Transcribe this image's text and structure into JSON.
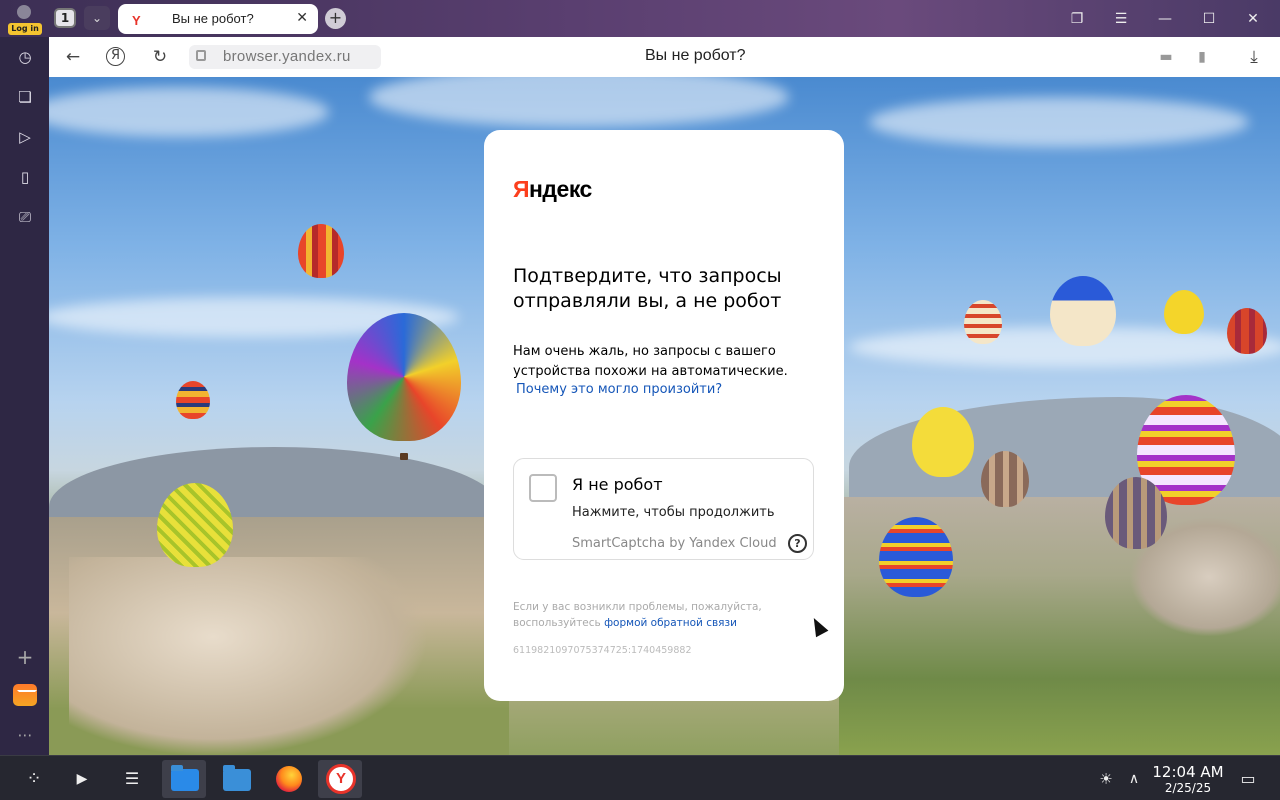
{
  "browser": {
    "tab_count": "1",
    "login_label": "Log in",
    "tab": {
      "title": "Вы не робот?",
      "favicon": "Y"
    },
    "url": "browser.yandex.ru",
    "page_title": "Вы не робот?"
  },
  "sidebar": {
    "icons": [
      "history-icon",
      "collections-icon",
      "play-icon",
      "notes-icon",
      "screenshot-icon",
      "add-icon",
      "mail-icon",
      "more-icon"
    ]
  },
  "card": {
    "logo_first": "Я",
    "logo_rest": "ндекс",
    "heading": "Подтвердите, что запросы отправляли вы, а не робот",
    "description": "Нам очень жаль, но запросы с вашего устройства похожи на автоматические.",
    "why_link": "Почему это могло произойти?",
    "captcha": {
      "label": "Я не робот",
      "sublabel": "Нажмите, чтобы продолжить",
      "brand": "SmartCaptcha by Yandex Cloud",
      "help": "?"
    },
    "feedback_text": "Если у вас возникли проблемы, пожалуйста, воспользуйтесь",
    "feedback_link": "формой обратной связи",
    "request_id": "6119821097075374725:1740459882"
  },
  "taskbar": {
    "time": "12:04 AM",
    "date": "2/25/25"
  },
  "colors": {
    "yandex_red": "#fc3f1d",
    "link_blue": "#1556b8",
    "sidebar_bg": "#2e2744",
    "taskbar_bg": "#262730"
  }
}
